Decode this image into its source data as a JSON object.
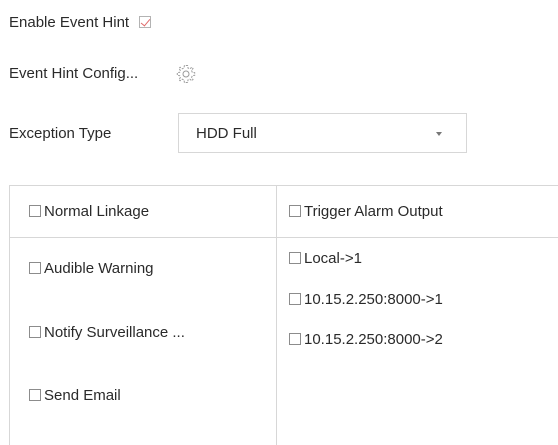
{
  "event_hint": {
    "label": "Enable Event Hint",
    "checked": true
  },
  "event_hint_config": {
    "label": "Event Hint Config...",
    "icon": "gear-icon"
  },
  "exception_type": {
    "label": "Exception Type",
    "selected": "HDD Full"
  },
  "linkage": {
    "normal_header": "Normal Linkage",
    "trigger_header": "Trigger Alarm Output",
    "normal_items": [
      {
        "label": "Audible Warning",
        "checked": false
      },
      {
        "label": "Notify Surveillance ...",
        "checked": false
      },
      {
        "label": "Send Email",
        "checked": false
      }
    ],
    "trigger_items": [
      {
        "label": "Local->1",
        "checked": false
      },
      {
        "label": "10.15.2.250:8000->1",
        "checked": false
      },
      {
        "label": "10.15.2.250:8000->2",
        "checked": false
      }
    ]
  },
  "colors": {
    "checkmark": "#e06a6a",
    "border": "#d7d7d7"
  }
}
